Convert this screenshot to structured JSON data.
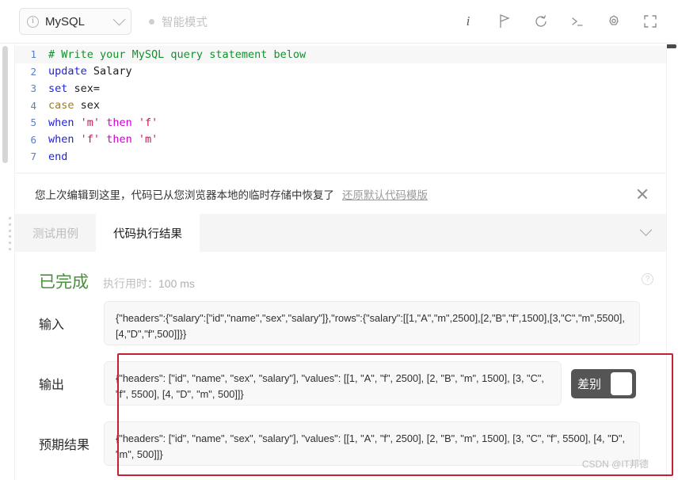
{
  "toolbar": {
    "language": "MySQL",
    "language_info_icon": "info-circle-icon",
    "dropdown_icon": "chevron-down-icon",
    "mode_label": "智能模式",
    "icons": [
      {
        "name": "info-icon",
        "glyph": "i"
      },
      {
        "name": "flag-icon",
        "glyph": "flag"
      },
      {
        "name": "reset-icon",
        "glyph": "undo"
      },
      {
        "name": "console-icon",
        "glyph": "terminal"
      },
      {
        "name": "settings-icon",
        "glyph": "gear"
      },
      {
        "name": "fullscreen-icon",
        "glyph": "expand"
      }
    ]
  },
  "editor": {
    "lines": [
      {
        "num": "1",
        "tokens": [
          {
            "t": "# Write your MySQL query statement below",
            "c": "tk-com"
          }
        ]
      },
      {
        "num": "2",
        "tokens": [
          {
            "t": "update",
            "c": "tk-kw"
          },
          {
            "t": " ",
            "c": ""
          },
          {
            "t": "Salary",
            "c": "tk-id"
          }
        ]
      },
      {
        "num": "3",
        "tokens": [
          {
            "t": "set",
            "c": "tk-kw"
          },
          {
            "t": " ",
            "c": ""
          },
          {
            "t": "sex=",
            "c": "tk-id"
          }
        ]
      },
      {
        "num": "4",
        "tokens": [
          {
            "t": "case",
            "c": "tk-fn"
          },
          {
            "t": " ",
            "c": ""
          },
          {
            "t": "sex",
            "c": "tk-id"
          }
        ]
      },
      {
        "num": "5",
        "tokens": [
          {
            "t": "when",
            "c": "tk-kw"
          },
          {
            "t": " ",
            "c": ""
          },
          {
            "t": "'m'",
            "c": "tk-str"
          },
          {
            "t": " ",
            "c": ""
          },
          {
            "t": "then",
            "c": "tk-kw2"
          },
          {
            "t": " ",
            "c": ""
          },
          {
            "t": "'f'",
            "c": "tk-str"
          }
        ]
      },
      {
        "num": "6",
        "tokens": [
          {
            "t": "when",
            "c": "tk-kw"
          },
          {
            "t": " ",
            "c": ""
          },
          {
            "t": "'f'",
            "c": "tk-str"
          },
          {
            "t": " ",
            "c": ""
          },
          {
            "t": "then",
            "c": "tk-kw2"
          },
          {
            "t": " ",
            "c": ""
          },
          {
            "t": "'m'",
            "c": "tk-str"
          }
        ]
      },
      {
        "num": "7",
        "tokens": [
          {
            "t": "end",
            "c": "tk-kw"
          }
        ]
      }
    ]
  },
  "notice": {
    "text": "您上次编辑到这里，代码已从您浏览器本地的临时存储中恢复了",
    "link": "还原默认代码模版",
    "close_icon": "close-icon"
  },
  "tabs": [
    {
      "label": "测试用例",
      "active": false
    },
    {
      "label": "代码执行结果",
      "active": true
    }
  ],
  "tab_collapse_icon": "chevron-down-icon",
  "result": {
    "status": "已完成",
    "runtime_label": "执行用时：",
    "runtime_value": "100 ms",
    "help_icon": "question-circle-icon",
    "status_color": "#4a8f3c",
    "rows": [
      {
        "id": "input",
        "label": "输入",
        "value": "{\"headers\":{\"salary\":[\"id\",\"name\",\"sex\",\"salary\"]},\"rows\":{\"salary\":[[1,\"A\",\"m\",2500],[2,\"B\",\"f\",1500],[3,\"C\",\"m\",5500],[4,\"D\",\"f\",500]]}}"
      },
      {
        "id": "output",
        "label": "输出",
        "value": "{\"headers\": [\"id\", \"name\", \"sex\", \"salary\"], \"values\": [[1, \"A\", \"f\", 2500], [2, \"B\", \"m\", 1500], [3, \"C\", \"f\", 5500], [4, \"D\", \"m\", 500]]}"
      },
      {
        "id": "expected",
        "label": "预期结果",
        "value": "{\"headers\": [\"id\", \"name\", \"sex\", \"salary\"], \"values\": [[1, \"A\", \"f\", 2500], [2, \"B\", \"m\", 1500], [3, \"C\", \"f\", 5500], [4, \"D\", \"m\", 500]]}"
      }
    ],
    "diff_toggle": {
      "label": "差别",
      "on": false
    }
  },
  "highlight_color": "#c52030",
  "watermark": "CSDN @IT邦德"
}
